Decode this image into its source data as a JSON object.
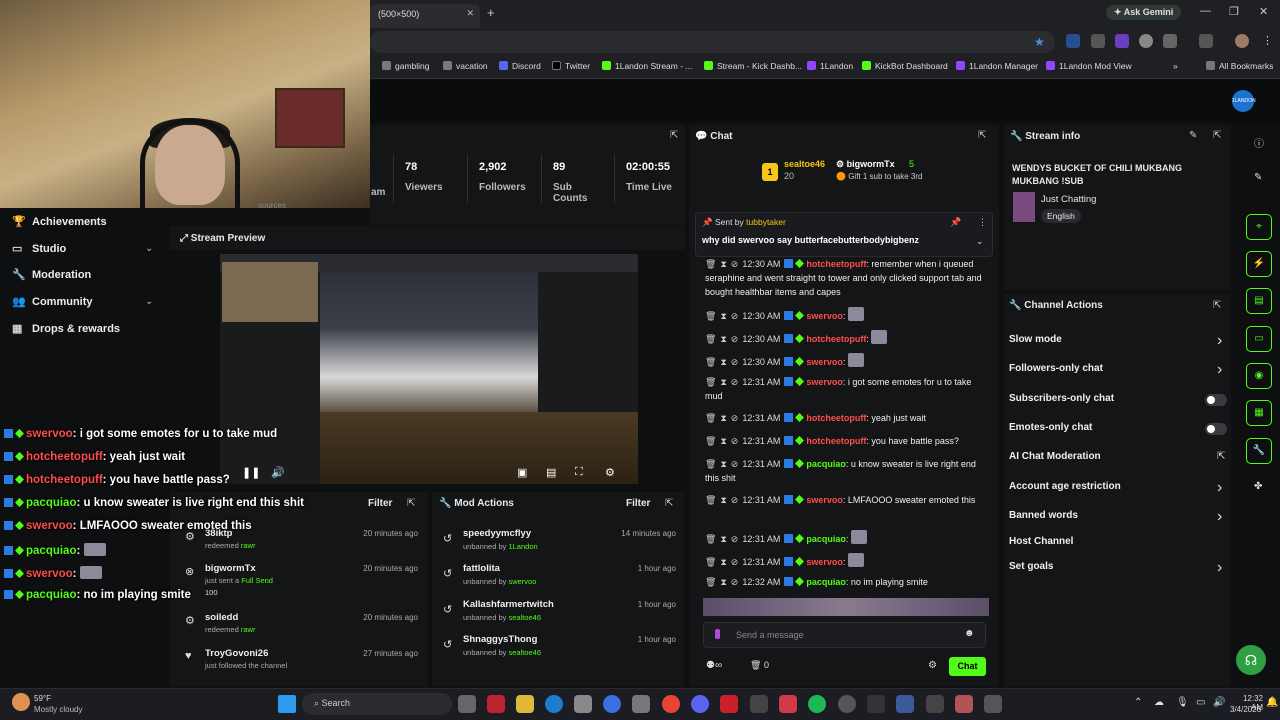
{
  "browser": {
    "tab_title": "(500×500)",
    "ask_gemini": "Ask Gemini",
    "bookmarks": [
      "gambling",
      "vacation",
      "Discord",
      "Twitter",
      "1Landon Stream - ...",
      "Stream - Kick Dashb...",
      "1Landon",
      "KickBot Dashboard",
      "1Landon Manager",
      "1Landon Mod View"
    ],
    "all_bookmarks": "All Bookmarks",
    "kick_logo": "1LANDON"
  },
  "stats": {
    "partial_label": "am",
    "partial_label2": "sources",
    "items": [
      {
        "value": "78",
        "label": "Viewers"
      },
      {
        "value": "2,902",
        "label": "Followers"
      },
      {
        "value": "89",
        "label": "Sub Counts"
      },
      {
        "value": "02:00:55",
        "label": "Time Live"
      }
    ]
  },
  "sidebar": {
    "items": [
      {
        "label": "Achievements",
        "icon": "trophy-icon"
      },
      {
        "label": "Studio",
        "icon": "tv-icon"
      },
      {
        "label": "Moderation",
        "icon": "wrench-icon"
      },
      {
        "label": "Community",
        "icon": "people-icon"
      },
      {
        "label": "Drops & rewards",
        "icon": "gift-icon"
      }
    ]
  },
  "preview": {
    "title": "Stream Preview"
  },
  "overlay_chat": [
    {
      "user": "swervoo",
      "text": ": i got some emotes for u to take mud",
      "color": "#ff4d4d"
    },
    {
      "user": "hotcheetopuff",
      "text": ": yeah just wait",
      "color": "#ff4d4d"
    },
    {
      "user": "hotcheetopuff",
      "text": ": you have battle pass?",
      "color": "#ff4d4d"
    },
    {
      "user": "pacquiao",
      "text": ": u know sweater is live right end this shit",
      "color": "#53fc18"
    },
    {
      "user": "swervoo",
      "text": ": LMFAOOO sweater emoted this",
      "color": "#ff4d4d"
    },
    {
      "user": "pacquiao",
      "text": ":",
      "color": "#53fc18"
    },
    {
      "user": "swervoo",
      "text": ":",
      "color": "#ff4d4d"
    },
    {
      "user": "pacquiao",
      "text": ": no im playing smite",
      "color": "#53fc18"
    }
  ],
  "activity": {
    "filter": "Filter",
    "rows": [
      {
        "name": "38iktp",
        "sub": "redeemed",
        "sub_hl": "rawr",
        "time": "20 minutes ago"
      },
      {
        "name": "bigwormTx",
        "sub": "just sent a",
        "sub_hl": "Full Send",
        "extra": "100",
        "time": "20 minutes ago"
      },
      {
        "name": "soiledd",
        "sub": "redeemed",
        "sub_hl": "rawr",
        "time": "20 minutes ago"
      },
      {
        "name": "TroyGovoni26",
        "sub": "just followed the channel",
        "sub_hl": "",
        "time": "27 minutes ago"
      }
    ]
  },
  "mod_actions": {
    "title": "Mod Actions",
    "filter": "Filter",
    "rows": [
      {
        "name": "speedyymcflyy",
        "sub": "unbanned by",
        "by": "1Landon",
        "time": "14 minutes ago"
      },
      {
        "name": "fattlolita",
        "sub": "unbanned by",
        "by": "swervoo",
        "time": "1 hour ago"
      },
      {
        "name": "Kallashfarmertwitch",
        "sub": "unbanned by",
        "by": "sealtoe46",
        "time": "1 hour ago"
      },
      {
        "name": "ShnaggysThong",
        "sub": "unbanned by",
        "by": "sealtoe46",
        "time": "1 hour ago"
      }
    ]
  },
  "chat": {
    "title": "Chat",
    "gifter1": "sealtoe46",
    "gifter1_count": "20",
    "gifter2": "bigwormTx",
    "gifter2_count": "5",
    "gift_note": "Gift 1 sub to take 3rd",
    "pinned_by_label": "Sent by",
    "pinned_by": "tubbytaker",
    "pinned_text": "why did swervoo say butterfacebutterbodybigbenz",
    "messages": [
      {
        "time": "12:30 AM",
        "user": "hotcheetopuff",
        "text": ": remember when i queued seraphine and went straight to tower and only clicked support tab and bought healthbar items and capes",
        "green": false
      },
      {
        "time": "12:30 AM",
        "user": "swervoo",
        "text": ":",
        "green": false
      },
      {
        "time": "12:30 AM",
        "user": "hotcheetopuff",
        "text": ":",
        "green": false
      },
      {
        "time": "12:30 AM",
        "user": "swervoo",
        "text": ":",
        "green": false
      },
      {
        "time": "12:31 AM",
        "user": "swervoo",
        "text": ": i got some emotes for u to take mud",
        "green": false
      },
      {
        "time": "12:31 AM",
        "user": "hotcheetopuff",
        "text": ": yeah just wait",
        "green": false
      },
      {
        "time": "12:31 AM",
        "user": "hotcheetopuff",
        "text": ": you have battle pass?",
        "green": false
      },
      {
        "time": "12:31 AM",
        "user": "pacquiao",
        "text": ": u know sweater is live right end this shit",
        "green": true
      },
      {
        "time": "12:31 AM",
        "user": "swervoo",
        "text": ": LMFAOOO sweater emoted this",
        "green": false
      },
      {
        "time": "12:31 AM",
        "user": "pacquiao",
        "text": ":",
        "green": true
      },
      {
        "time": "12:31 AM",
        "user": "swervoo",
        "text": ":",
        "green": false
      },
      {
        "time": "12:32 AM",
        "user": "pacquiao",
        "text": ": no im playing smite",
        "green": true
      }
    ],
    "placeholder": "Send a message",
    "count": "0",
    "send": "Chat"
  },
  "stream_info": {
    "title": "Stream info",
    "stream_title": "WENDYS BUCKET OF CHILI MUKBANG MUKBANG !SUB",
    "category": "Just Chatting",
    "language": "English"
  },
  "channel_actions": {
    "title": "Channel Actions",
    "items": [
      {
        "label": "Slow mode",
        "kind": "arrow"
      },
      {
        "label": "Followers-only chat",
        "kind": "arrow"
      },
      {
        "label": "Subscribers-only chat",
        "kind": "toggle"
      },
      {
        "label": "Emotes-only chat",
        "kind": "toggle"
      },
      {
        "label": "AI Chat Moderation",
        "kind": "external"
      },
      {
        "label": "Account age restriction",
        "kind": "arrow"
      },
      {
        "label": "Banned words",
        "kind": "arrow"
      },
      {
        "label": "Host Channel",
        "kind": "none"
      },
      {
        "label": "Set goals",
        "kind": "arrow"
      }
    ]
  },
  "taskbar": {
    "weather_temp": "59°F",
    "weather_desc": "Mostly cloudy",
    "search": "Search",
    "time": "12:32 AM",
    "date": "3/4/2026"
  },
  "colors": {
    "accent": "#53fc18",
    "red_user": "#ff4d4d",
    "panel": "#141517"
  }
}
